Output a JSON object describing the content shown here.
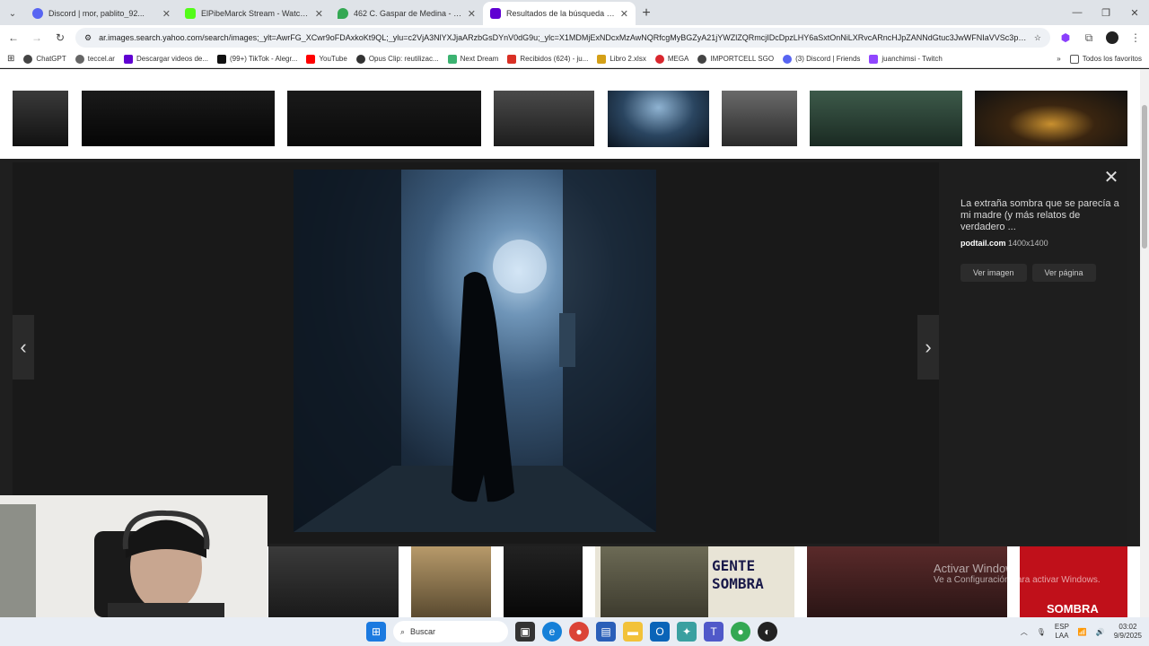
{
  "browser": {
    "tabs": [
      {
        "title": "Discord | mor, pablito_92...",
        "favicon_color": "#5865f2",
        "active": false
      },
      {
        "title": "ElPibeMarck Stream - Watch Li...",
        "favicon_color": "#53fc18",
        "active": false
      },
      {
        "title": "462 C. Gaspar de Medina - Goo...",
        "favicon_color": "#34a853",
        "active": false
      },
      {
        "title": "Resultados de la búsqueda de...",
        "favicon_color": "#6001d2",
        "active": true
      }
    ],
    "new_tab_icon": "+",
    "url": "ar.images.search.yahoo.com/search/images;_ylt=AwrFG_XCwr9oFDAxkoKt9QL;_ylu=c2VjA3NlYXJjaARzbGsDYnV0dG9u;_ylc=X1MDMjExNDcxMzAwNQRfcgMyBGZyA21jYWZlZQRmcjIDcDpzLHY6aSxtOnNiLXRvcARncHJpZANNdGtuc3JwWFNIaVVSc3plb..."
  },
  "bookmarks": [
    {
      "label": "ChatGPT",
      "color": "#444"
    },
    {
      "label": "teccel.ar",
      "color": "#666"
    },
    {
      "label": "Descargar videos de...",
      "color": "#6001d2"
    },
    {
      "label": "(99+) TikTok - Alegr...",
      "color": "#111"
    },
    {
      "label": "YouTube",
      "color": "#ff0000"
    },
    {
      "label": "Opus Clip: reutilizac...",
      "color": "#333"
    },
    {
      "label": "Next Dream",
      "color": "#3cb371"
    },
    {
      "label": "Recibidos (624) - ju...",
      "color": "#d93025"
    },
    {
      "label": "Libro 2.xlsx",
      "color": "#d4a017"
    },
    {
      "label": "MEGA",
      "color": "#d9272e"
    },
    {
      "label": "IMPORTCELL SGO",
      "color": "#444"
    },
    {
      "label": "(3) Discord | Friends",
      "color": "#5865f2"
    },
    {
      "label": "juanchimsi - Twitch",
      "color": "#9146ff"
    }
  ],
  "bookmarks_all": "Todos los favoritos",
  "viewer": {
    "title": "La extraña sombra que se parecía a mi madre (y más relatos de verdadero ...",
    "source": "podtail.com",
    "dimensions": "1400x1400",
    "btn_view_image": "Ver imagen",
    "btn_view_page": "Ver página",
    "prev_icon": "‹",
    "next_icon": "›",
    "close_icon": "✕"
  },
  "bottom_strip": {
    "caption": "GENTE SOMBRA",
    "caption2": "SOMBRA"
  },
  "watermark": {
    "line1": "Activar Windows",
    "line2": "Ve a Configuración para activar Windows."
  },
  "taskbar": {
    "search_placeholder": "Buscar",
    "lang_top": "ESP",
    "lang_bottom": "LAA",
    "time": "03:02",
    "date": "9/9/2025"
  }
}
